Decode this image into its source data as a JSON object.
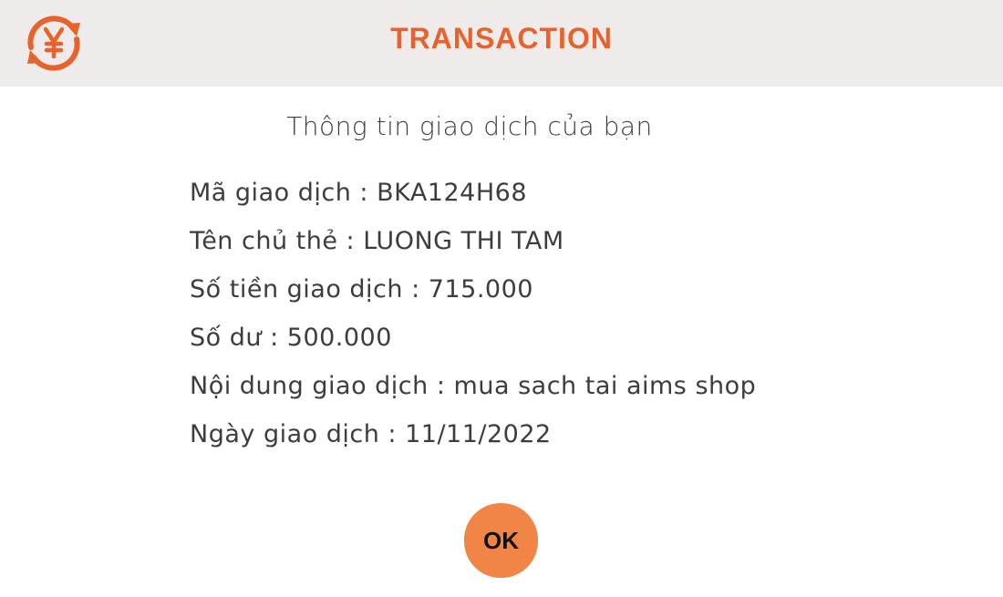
{
  "header": {
    "title": "TRANSACTION",
    "logo_icon": "currency-exchange-yen-icon",
    "accent_color": "#e8632b"
  },
  "subtitle": "Thông tin giao dịch của bạn",
  "details": [
    {
      "label": "Mã giao dịch",
      "value": "BKA124H68"
    },
    {
      "label": "Tên chủ thẻ",
      "value": "LUONG THI TAM"
    },
    {
      "label": "Số tiền giao dịch",
      "value": "715.000"
    },
    {
      "label": "Số dư",
      "value": "500.000"
    },
    {
      "label": "Nội dung giao dịch",
      "value": "mua sach tai aims shop"
    },
    {
      "label": "Ngày giao dịch",
      "value": "11/11/2022"
    }
  ],
  "ok_button": {
    "label": "OK",
    "color": "#f08545"
  }
}
